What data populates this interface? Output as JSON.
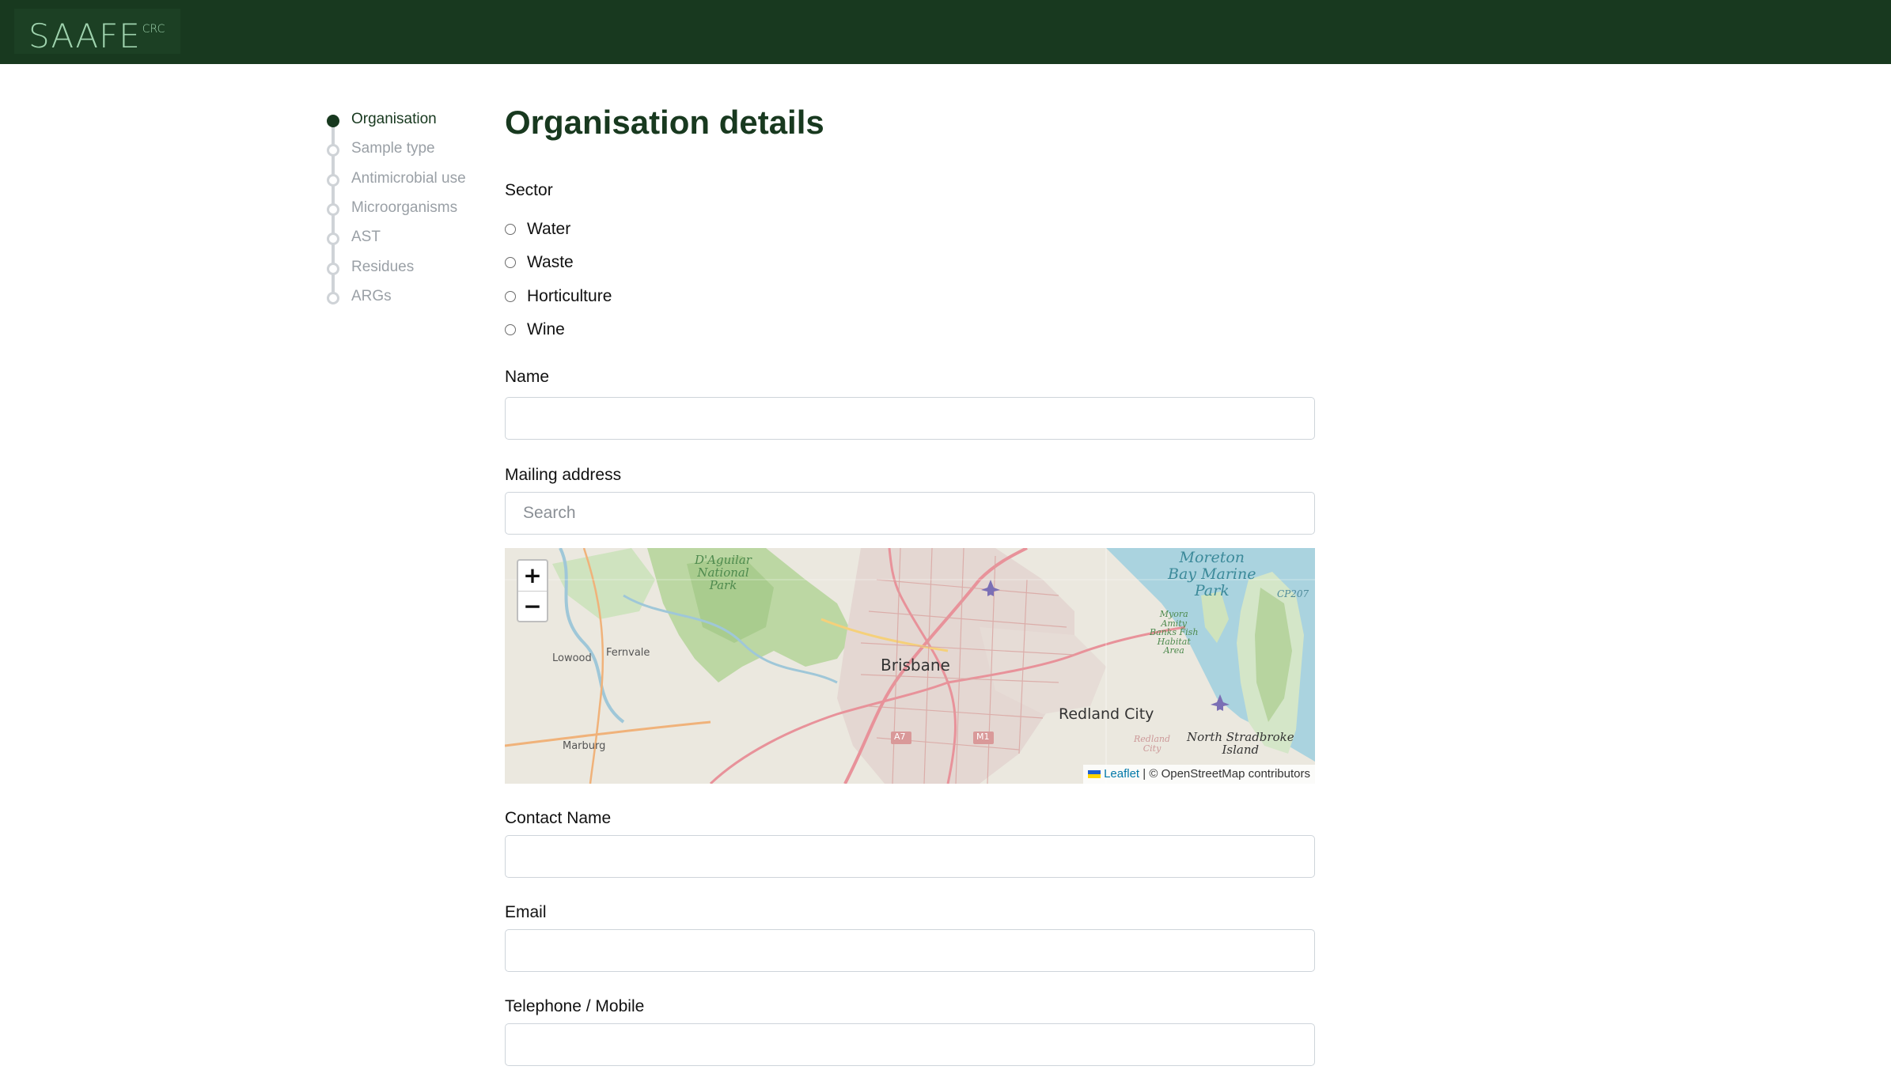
{
  "header": {
    "logo_text": "SAAFE",
    "logo_sup": "CRC"
  },
  "stepper": {
    "steps": [
      {
        "label": "Organisation",
        "active": true
      },
      {
        "label": "Sample type"
      },
      {
        "label": "Antimicrobial use"
      },
      {
        "label": "Microorganisms"
      },
      {
        "label": "AST"
      },
      {
        "label": "Residues"
      },
      {
        "label": "ARGs"
      }
    ]
  },
  "form": {
    "title": "Organisation details",
    "sector": {
      "label": "Sector",
      "options": [
        "Water",
        "Waste",
        "Horticulture",
        "Wine"
      ]
    },
    "name": {
      "label": "Name",
      "value": ""
    },
    "mailing": {
      "label": "Mailing address",
      "placeholder": "Search"
    },
    "contact_name": {
      "label": "Contact Name",
      "value": ""
    },
    "email": {
      "label": "Email",
      "value": ""
    },
    "phone": {
      "label": "Telephone / Mobile",
      "value": ""
    }
  },
  "map": {
    "zoom_in": "+",
    "zoom_out": "−",
    "attribution_link": "Leaflet",
    "attribution_text": "| © OpenStreetMap contributors",
    "places": {
      "brisbane": "Brisbane",
      "redland": "Redland City",
      "lowood": "Lowood",
      "fernvale": "Fernvale",
      "marburg": "Marburg",
      "north_stradbroke": "North Stradbroke",
      "island": "Island",
      "d_aguilar_1": "D'Aguilar",
      "d_aguilar_2": "National",
      "d_aguilar_3": "Park",
      "moreton_1": "Moreton",
      "moreton_2": "Bay Marine",
      "moreton_3": "Park",
      "myora_1": "Myora",
      "myora_2": "Amity",
      "myora_3": "Banks Fish",
      "myora_4": "Habitat",
      "myora_5": "Area",
      "redland_small_1": "Redland",
      "redland_small_2": "City",
      "cp207": "CP207",
      "a7": "A7",
      "m1": "M1"
    }
  }
}
